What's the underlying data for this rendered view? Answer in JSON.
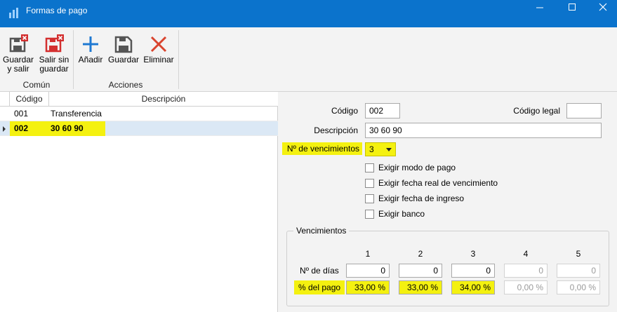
{
  "window": {
    "title": "Formas de pago",
    "minimize_icon": "minimize-icon",
    "maximize_icon": "maximize-icon",
    "close_icon": "close-icon",
    "accent": "#0b73cc"
  },
  "ribbon": {
    "groups": [
      {
        "label": "Común",
        "buttons": [
          {
            "label": "Guardar\ny salir",
            "icon": "save-exit-icon"
          },
          {
            "label": "Salir sin\nguardar",
            "icon": "exit-no-save-icon"
          }
        ]
      },
      {
        "label": "Acciones",
        "buttons": [
          {
            "label": "Añadir",
            "icon": "add-icon"
          },
          {
            "label": "Guardar",
            "icon": "save-icon"
          },
          {
            "label": "Eliminar",
            "icon": "delete-icon"
          }
        ]
      }
    ]
  },
  "grid": {
    "columns": [
      "Código",
      "Descripción"
    ],
    "rows": [
      {
        "codigo": "001",
        "descripcion": "Transferencia",
        "selected": false
      },
      {
        "codigo": "002",
        "descripcion": "30 60 90",
        "selected": true
      }
    ]
  },
  "form": {
    "codigo_label": "Código",
    "codigo_value": "002",
    "codigo_legal_label": "Código legal",
    "codigo_legal_value": "",
    "descripcion_label": "Descripción",
    "descripcion_value": "30 60 90",
    "vencimientos_label": "Nº de vencimientos",
    "vencimientos_value": "3",
    "checks": [
      {
        "label": "Exigir modo de pago",
        "checked": false
      },
      {
        "label": "Exigir fecha real de vencimiento",
        "checked": false
      },
      {
        "label": "Exigir fecha de ingreso",
        "checked": false
      },
      {
        "label": "Exigir banco",
        "checked": false
      }
    ]
  },
  "vencimientos": {
    "legend": "Vencimientos",
    "columns": [
      "1",
      "2",
      "3",
      "4",
      "5"
    ],
    "dias_label": "Nº de días",
    "dias": [
      "0",
      "0",
      "0",
      "0",
      "0"
    ],
    "pago_label": "% del pago",
    "pago": [
      "33,00 %",
      "33,00 %",
      "34,00 %",
      "0,00 %",
      "0,00 %"
    ],
    "enabled_count": 3
  }
}
